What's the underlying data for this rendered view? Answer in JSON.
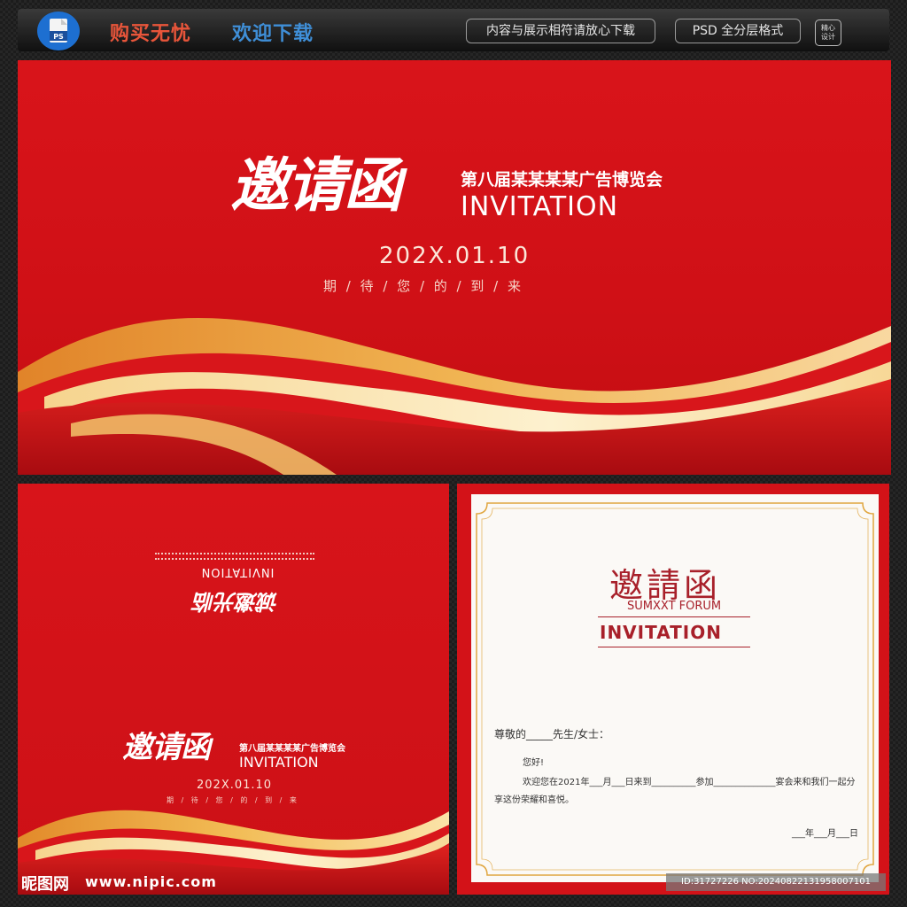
{
  "header": {
    "buy_text": "购买无忧",
    "welcome_text": "欢迎下载",
    "notice_badge": "内容与展示相符请放心下载",
    "format_badge": "PSD 全分层格式",
    "seal_line1": "精心",
    "seal_line2": "设计",
    "ps_icon_label": "PS"
  },
  "cover": {
    "title_calligraphy": "邀请函",
    "event_name": "第八届某某某某广告博览会",
    "invitation_en": "INVITATION",
    "date": "202X.01.10",
    "tagline": "期 / 待 / 您 / 的 / 到 / 来"
  },
  "back_cover": {
    "invitation_en": "INVITATION",
    "calligraphy": "诚邀光临"
  },
  "inner_page": {
    "calligraphy_logo": "邀請函",
    "forum": "SUMXXT FORUM",
    "invitation_en": "INVITATION",
    "salutation": "尊敬的_____先生/女士：",
    "greeting": "您好!",
    "body_line1": "欢迎您在2021年___月___日来到__________参加______________宴会来和我们一起分",
    "body_line2": "享这份荣耀和喜悦。",
    "date_fill": "___年___月___日"
  },
  "watermark": {
    "site_logo": "昵图网",
    "site_url": "www.nipic.com",
    "image_id": "ID:31727226 NO:20240822131958007101"
  },
  "colors": {
    "red": "#d31218",
    "gold": "#e8a23c",
    "cream": "#fbe3a8",
    "burgundy": "#a8202a"
  }
}
